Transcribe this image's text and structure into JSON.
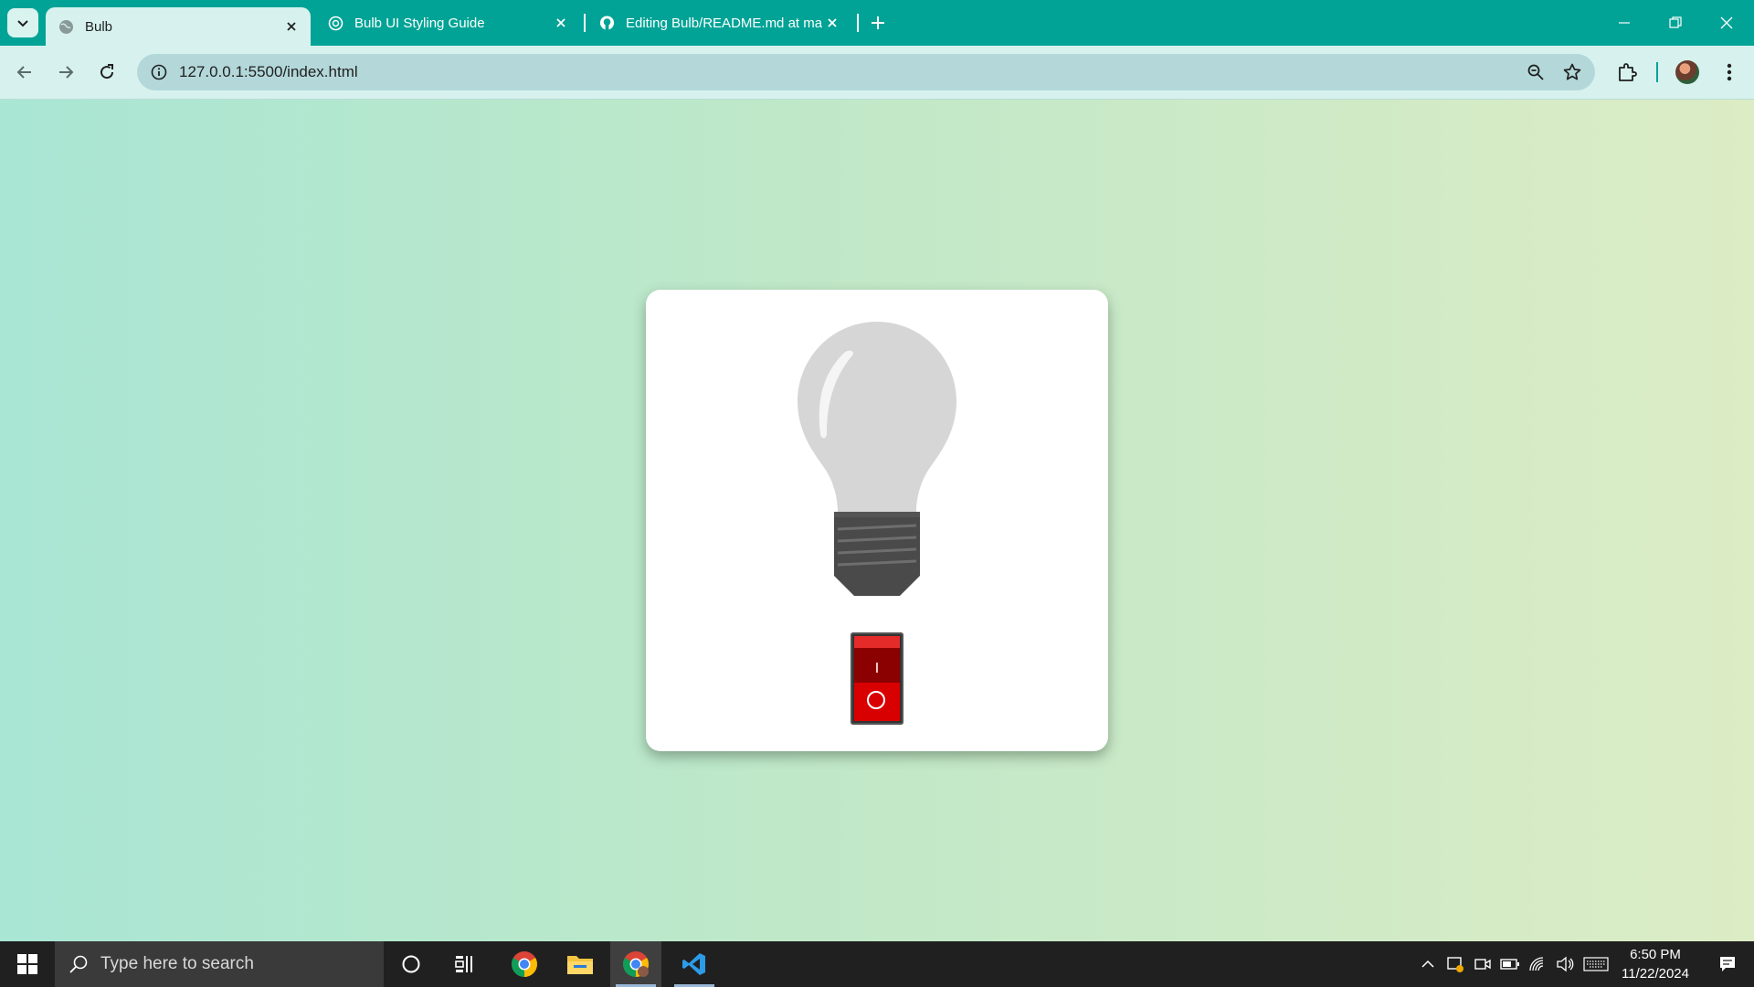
{
  "browser": {
    "tabs": [
      {
        "title": "Bulb",
        "favicon": "globe-icon",
        "active": true
      },
      {
        "title": "Bulb UI Styling Guide",
        "favicon": "chatgpt-icon",
        "active": false
      },
      {
        "title": "Editing Bulb/README.md at ma",
        "favicon": "github-icon",
        "active": false
      }
    ],
    "url": "127.0.0.1:5500/index.html",
    "colors": {
      "frame": "#00a396",
      "toolbar": "#d7f2ee",
      "omnibox": "#b4d8da"
    }
  },
  "page": {
    "bulb_state": "off",
    "switch": {
      "on_symbol": "I",
      "off_symbol": "O",
      "position": "off"
    },
    "colors": {
      "bulb_glass": "#d6d6d6",
      "bulb_base": "#4a4a4a",
      "switch": "#d80000",
      "card": "#ffffff"
    }
  },
  "taskbar": {
    "search_placeholder": "Type here to search",
    "pinned_apps": [
      "cortana-icon",
      "task-view-icon",
      "chrome-icon",
      "file-explorer-icon",
      "chrome-profile-icon",
      "vscode-icon"
    ],
    "clock": {
      "time": "6:50 PM",
      "date": "11/22/2024"
    }
  }
}
